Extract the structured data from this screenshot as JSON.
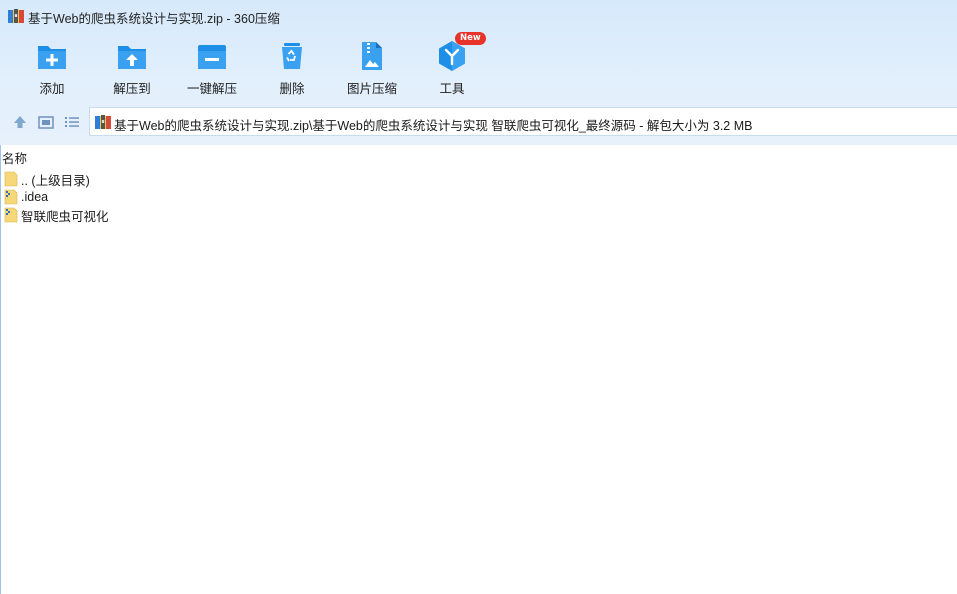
{
  "window": {
    "title": "基于Web的爬虫系统设计与实现.zip - 360压缩"
  },
  "toolbar": {
    "items": [
      {
        "label": "添加",
        "icon": "add-archive-icon"
      },
      {
        "label": "解压到",
        "icon": "extract-to-icon"
      },
      {
        "label": "一键解压",
        "icon": "one-click-extract-icon"
      },
      {
        "label": "删除",
        "icon": "recycle-bin-icon"
      },
      {
        "label": "图片压缩",
        "icon": "image-compress-icon"
      },
      {
        "label": "工具",
        "icon": "tools-icon",
        "badge": "New"
      }
    ]
  },
  "navigation": {
    "buttons": [
      "up-level-icon",
      "thumbnail-view-icon",
      "list-view-icon"
    ],
    "address": "基于Web的爬虫系统设计与实现.zip\\基于Web的爬虫系统设计与实现 智联爬虫可视化_最终源码 - 解包大小为 3.2 MB"
  },
  "file_list": {
    "column_header": "名称",
    "rows": [
      {
        "name": ".. (上级目录)",
        "type": "parent-folder"
      },
      {
        "name": ".idea",
        "type": "folder"
      },
      {
        "name": "智联爬虫可视化",
        "type": "folder"
      }
    ]
  },
  "colors": {
    "accent_blue": "#1e8fe6",
    "toolbar_bg": "#dcecfb",
    "badge_red": "#e8332a",
    "folder_yellow": "#f6d77a"
  }
}
